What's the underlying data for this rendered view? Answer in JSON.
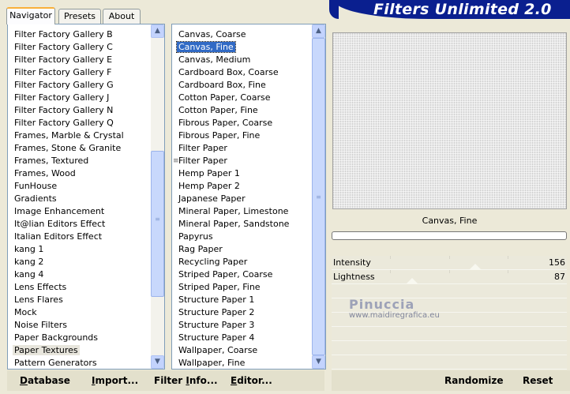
{
  "tabs": [
    {
      "label": "Navigator",
      "active": true
    },
    {
      "label": "Presets",
      "active": false
    },
    {
      "label": "About",
      "active": false
    }
  ],
  "app_title": "Filters Unlimited 2.0",
  "categories": [
    "Filter Factory Gallery B",
    "Filter Factory Gallery C",
    "Filter Factory Gallery E",
    "Filter Factory Gallery F",
    "Filter Factory Gallery G",
    "Filter Factory Gallery J",
    "Filter Factory Gallery N",
    "Filter Factory Gallery Q",
    "Frames, Marble & Crystal",
    "Frames, Stone & Granite",
    "Frames, Textured",
    "Frames, Wood",
    "FunHouse",
    "Gradients",
    "Image Enhancement",
    "It@lian Editors Effect",
    "Italian Editors Effect",
    "kang 1",
    "kang 2",
    "kang 4",
    "Lens Effects",
    "Lens Flares",
    "Mock",
    "Noise Filters",
    "Paper Backgrounds",
    "Paper Textures",
    "Pattern Generators"
  ],
  "selected_category": "Paper Textures",
  "filters": [
    "Canvas, Coarse",
    "Canvas, Fine",
    "Canvas, Medium",
    "Cardboard Box, Coarse",
    "Cardboard Box, Fine",
    "Cotton Paper, Coarse",
    "Cotton Paper, Fine",
    "Fibrous Paper, Coarse",
    "Fibrous Paper, Fine",
    "Filter Paper",
    "Filter Paper",
    "Hemp Paper 1",
    "Hemp Paper 2",
    "Japanese Paper",
    "Mineral Paper, Limestone",
    "Mineral Paper, Sandstone",
    "Papyrus",
    "Rag Paper",
    "Recycling Paper",
    "Striped Paper, Coarse",
    "Striped Paper, Fine",
    "Structure Paper 1",
    "Structure Paper 2",
    "Structure Paper 3",
    "Structure Paper 4",
    "Wallpaper, Coarse",
    "Wallpaper, Fine"
  ],
  "selected_filter": "Canvas, Fine",
  "preview": {
    "filter_name": "Canvas, Fine"
  },
  "progress": 0,
  "params": [
    {
      "label": "Intensity",
      "value": "156",
      "fraction": 0.612
    },
    {
      "label": "Lightness",
      "value": "87",
      "fraction": 0.341
    }
  ],
  "watermark": {
    "name": "Pinuccia",
    "url": "www.maidiregrafica.eu"
  },
  "buttons": {
    "database": {
      "u": "D",
      "rest": "atabase"
    },
    "import": {
      "u": "I",
      "rest": "mport..."
    },
    "filter_info": {
      "pre": "Filter ",
      "u": "I",
      "rest": "nfo..."
    },
    "editor": {
      "u": "E",
      "rest": "ditor..."
    },
    "randomize": "Randomize",
    "reset": "Reset"
  },
  "colors": {
    "title_bg": "#0a1f8f",
    "selection_blue": "#316ac5",
    "selection_gray": "#e7e5dc",
    "window_bg": "#ece9d8",
    "scrollbar": "#c3d3fd"
  }
}
